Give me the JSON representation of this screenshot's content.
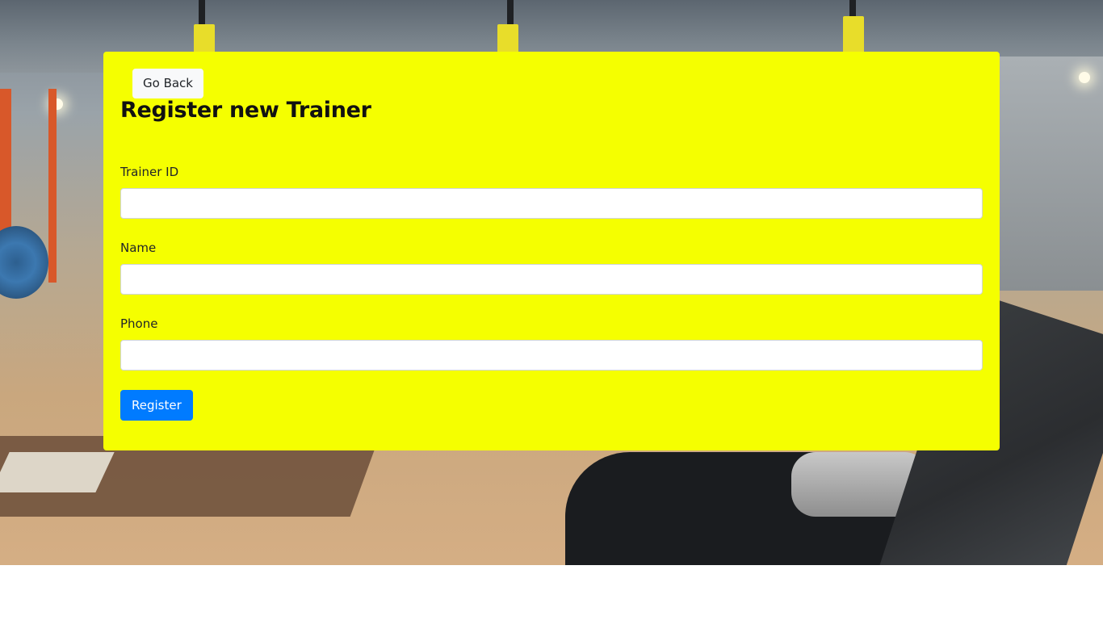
{
  "page": {
    "background_theme": "gym-photo"
  },
  "card": {
    "background_color": "#f5ff00",
    "back_button_label": "Go Back",
    "title": "Register new Trainer",
    "fields": [
      {
        "label": "Trainer ID",
        "value": "",
        "placeholder": ""
      },
      {
        "label": "Name",
        "value": "",
        "placeholder": ""
      },
      {
        "label": "Phone",
        "value": "",
        "placeholder": ""
      }
    ],
    "submit_label": "Register",
    "submit_color": "#007bff"
  }
}
